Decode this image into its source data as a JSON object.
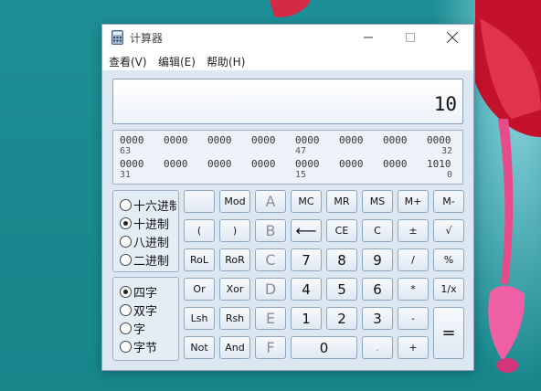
{
  "window": {
    "title": "计算器",
    "menu": [
      "查看(V)",
      "编辑(E)",
      "帮助(H)"
    ]
  },
  "display": {
    "value": "10"
  },
  "bits": {
    "row1": [
      "0000",
      "0000",
      "0000",
      "0000",
      "0000",
      "0000",
      "0000",
      "0000"
    ],
    "row1_labels": [
      "63",
      "47",
      "32"
    ],
    "row2": [
      "0000",
      "0000",
      "0000",
      "0000",
      "0000",
      "0000",
      "0000",
      "1010"
    ],
    "row2_labels": [
      "31",
      "15",
      "0"
    ]
  },
  "bases": {
    "options": [
      "十六进制",
      "十进制",
      "八进制",
      "二进制"
    ],
    "selected_index": 1
  },
  "word_sizes": {
    "options": [
      "四字",
      "双字",
      "字",
      "字节"
    ],
    "selected_index": 0
  },
  "buttons": {
    "quot": "",
    "mod": "Mod",
    "A": "A",
    "MC": "MC",
    "MR": "MR",
    "MS": "MS",
    "Mplus": "M+",
    "Mminus": "M-",
    "lparen": "(",
    "rparen": ")",
    "B": "B",
    "back": "⟵",
    "CE": "CE",
    "C": "C",
    "pm": "±",
    "sqrt": "√",
    "RoL": "RoL",
    "RoR": "RoR",
    "Cc": "C",
    "n7": "7",
    "n8": "8",
    "n9": "9",
    "div": "/",
    "pct": "%",
    "Or": "Or",
    "Xor": "Xor",
    "D": "D",
    "n4": "4",
    "n5": "5",
    "n6": "6",
    "mul": "*",
    "recip": "1/x",
    "Lsh": "Lsh",
    "Rsh": "Rsh",
    "E": "E",
    "n1": "1",
    "n2": "2",
    "n3": "3",
    "sub": "-",
    "eq": "=",
    "Not": "Not",
    "And": "And",
    "F": "F",
    "n0": "0",
    "dot": ".",
    "add": "+"
  }
}
